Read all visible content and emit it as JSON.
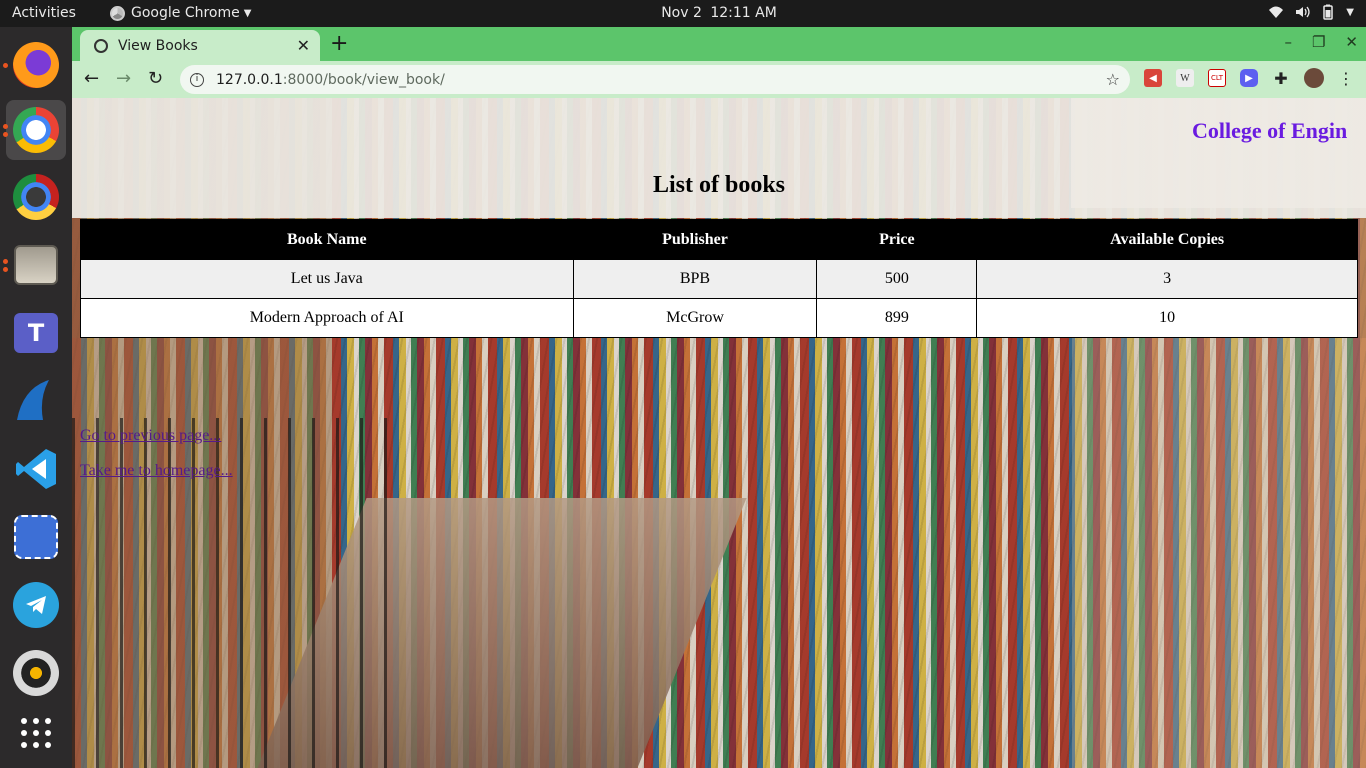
{
  "system_bar": {
    "activities": "Activities",
    "app_name": "Google Chrome",
    "date": "Nov 2",
    "time": "12:11 AM",
    "tray_icons": [
      "wifi-icon",
      "volume-icon",
      "battery-icon",
      "power-menu-icon"
    ]
  },
  "dock": {
    "apps": [
      "firefox",
      "google-chrome",
      "google-chrome-dev",
      "files",
      "microsoft-teams",
      "wireshark",
      "vscode",
      "screenshot-tool",
      "telegram",
      "rhythmbox",
      "show-apps"
    ],
    "colors": {
      "firefox": "#ff7a1a",
      "chrome": "#4285f4",
      "teams": "#5b5fc7",
      "vscode": "#2aa0e8",
      "telegram": "#2aa3dd"
    }
  },
  "browser": {
    "tab_title": "View Books",
    "url_host": "127.0.0.1",
    "url_path": ":8000/book/view_book/",
    "extension_icons": [
      "megaphone-icon",
      "wiki-icon",
      "extension-icon",
      "zoom-icon",
      "puzzle-icon",
      "profile-avatar"
    ],
    "theme_color": "#5cc56b"
  },
  "page": {
    "college_title": "College of Engin",
    "heading": "List of books",
    "table": {
      "headers": [
        "Book Name",
        "Publisher",
        "Price",
        "Available Copies"
      ],
      "rows": [
        [
          "Let us Java",
          "BPB",
          "500",
          "3"
        ],
        [
          "Modern Approach of AI",
          "McGrow",
          "899",
          "10"
        ]
      ]
    },
    "links": {
      "previous": "Go to previous page...",
      "home": "Take me to homepage..."
    },
    "link_color": "#551a8b",
    "college_color": "#6a1be0"
  }
}
